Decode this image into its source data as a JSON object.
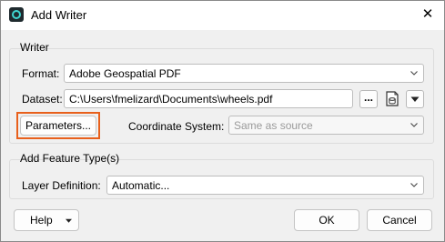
{
  "window": {
    "title": "Add Writer",
    "close_glyph": "✕"
  },
  "writer": {
    "group_title": "Writer",
    "format_label": "Format:",
    "format_value": "Adobe Geospatial PDF",
    "dataset_label": "Dataset:",
    "dataset_value": "C:\\Users\\fmelizard\\Documents\\wheels.pdf",
    "browse_label": "...",
    "parameters_label": "Parameters...",
    "coord_label": "Coordinate System:",
    "coord_placeholder": "Same as source"
  },
  "feature_types": {
    "group_title": "Add Feature Type(s)",
    "layer_label": "Layer Definition:",
    "layer_value": "Automatic..."
  },
  "footer": {
    "help_label": "Help",
    "ok_label": "OK",
    "cancel_label": "Cancel"
  },
  "icons": {
    "app": "app-icon",
    "close": "close-icon",
    "chevron": "chevron-down-icon",
    "file_reader": "file-reader-icon",
    "dropdown": "dropdown-arrow-icon"
  },
  "colors": {
    "highlight": "#e8601c",
    "app_icon_accent": "#3fd6d0"
  }
}
